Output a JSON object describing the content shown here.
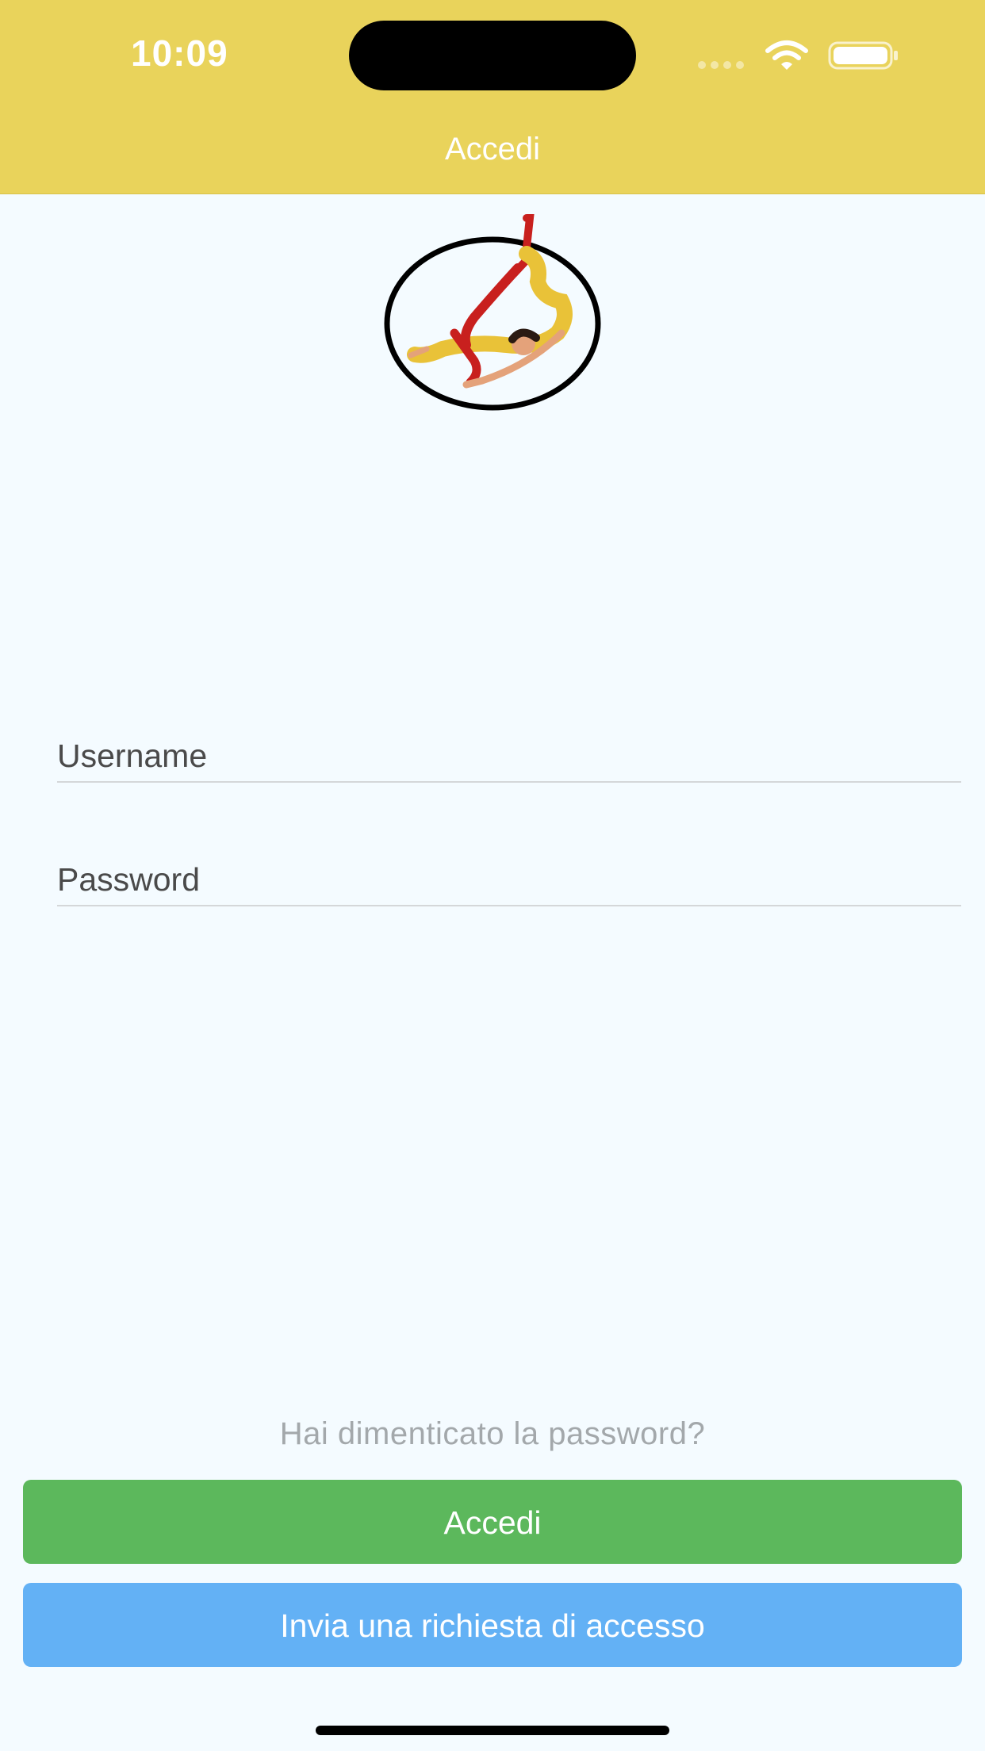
{
  "status_bar": {
    "time": "10:09"
  },
  "nav": {
    "title": "Accedi"
  },
  "logo": {
    "icon": "aerial-silks-dancer-logo"
  },
  "form": {
    "username_placeholder": "Username",
    "password_placeholder": "Password"
  },
  "links": {
    "forgot_password": "Hai dimenticato la password?"
  },
  "buttons": {
    "login": "Accedi",
    "request_access": "Invia una richiesta di accesso"
  },
  "colors": {
    "header": "#e9d35b",
    "background": "#f4fbff",
    "login_button": "#5cb85c",
    "request_button": "#63b1f5"
  }
}
